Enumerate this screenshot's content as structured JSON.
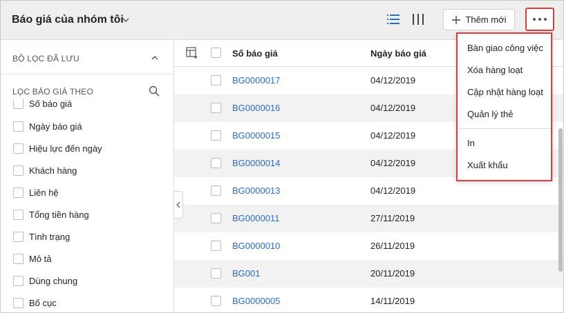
{
  "header": {
    "title": "Báo giá của nhóm tôi",
    "add_label": "Thêm mới"
  },
  "sidebar": {
    "saved_filters_label": "BỘ LỌC ĐÃ LƯU",
    "filter_by_label": "LỌC BÁO GIÁ THEO",
    "items": [
      {
        "label": "Số báo giá"
      },
      {
        "label": "Ngày báo giá"
      },
      {
        "label": "Hiệu lực đến ngày"
      },
      {
        "label": "Khách hàng"
      },
      {
        "label": "Liên hệ"
      },
      {
        "label": "Tổng tiền hàng"
      },
      {
        "label": "Tình trạng"
      },
      {
        "label": "Mô tả"
      },
      {
        "label": "Dùng chung"
      },
      {
        "label": "Bố cục"
      }
    ]
  },
  "table": {
    "columns": {
      "number": "Số báo giá",
      "date": "Ngày báo giá"
    },
    "rows": [
      {
        "number": "BG0000017",
        "date": "04/12/2019"
      },
      {
        "number": "BG0000016",
        "date": "04/12/2019"
      },
      {
        "number": "BG0000015",
        "date": "04/12/2019"
      },
      {
        "number": "BG0000014",
        "date": "04/12/2019"
      },
      {
        "number": "BG0000013",
        "date": "04/12/2019"
      },
      {
        "number": "BG0000011",
        "date": "27/11/2019"
      },
      {
        "number": "BG0000010",
        "date": "26/11/2019"
      },
      {
        "number": "BG001",
        "date": "20/11/2019"
      },
      {
        "number": "BG0000005",
        "date": "14/11/2019"
      }
    ]
  },
  "menu": {
    "items": [
      {
        "label": "Bàn giao công việc"
      },
      {
        "label": "Xóa hàng loạt"
      },
      {
        "label": "Cập nhật hàng loạt"
      },
      {
        "label": "Quản lý thẻ"
      },
      {
        "label": "In"
      },
      {
        "label": "Xuất khẩu"
      }
    ]
  },
  "colors": {
    "link": "#2b6cc4",
    "highlight": "#e0393e",
    "active_icon": "#2b6cc4"
  },
  "icons": {
    "title_chevron": "chevron-down-icon",
    "list_view": "list-view-icon",
    "column_view": "column-view-icon",
    "add": "plus-icon",
    "more": "more-dots-icon",
    "saved_chevron": "chevron-up-icon",
    "filter_search": "search-icon",
    "column_settings": "column-settings-icon",
    "collapse": "chevron-left-icon"
  }
}
